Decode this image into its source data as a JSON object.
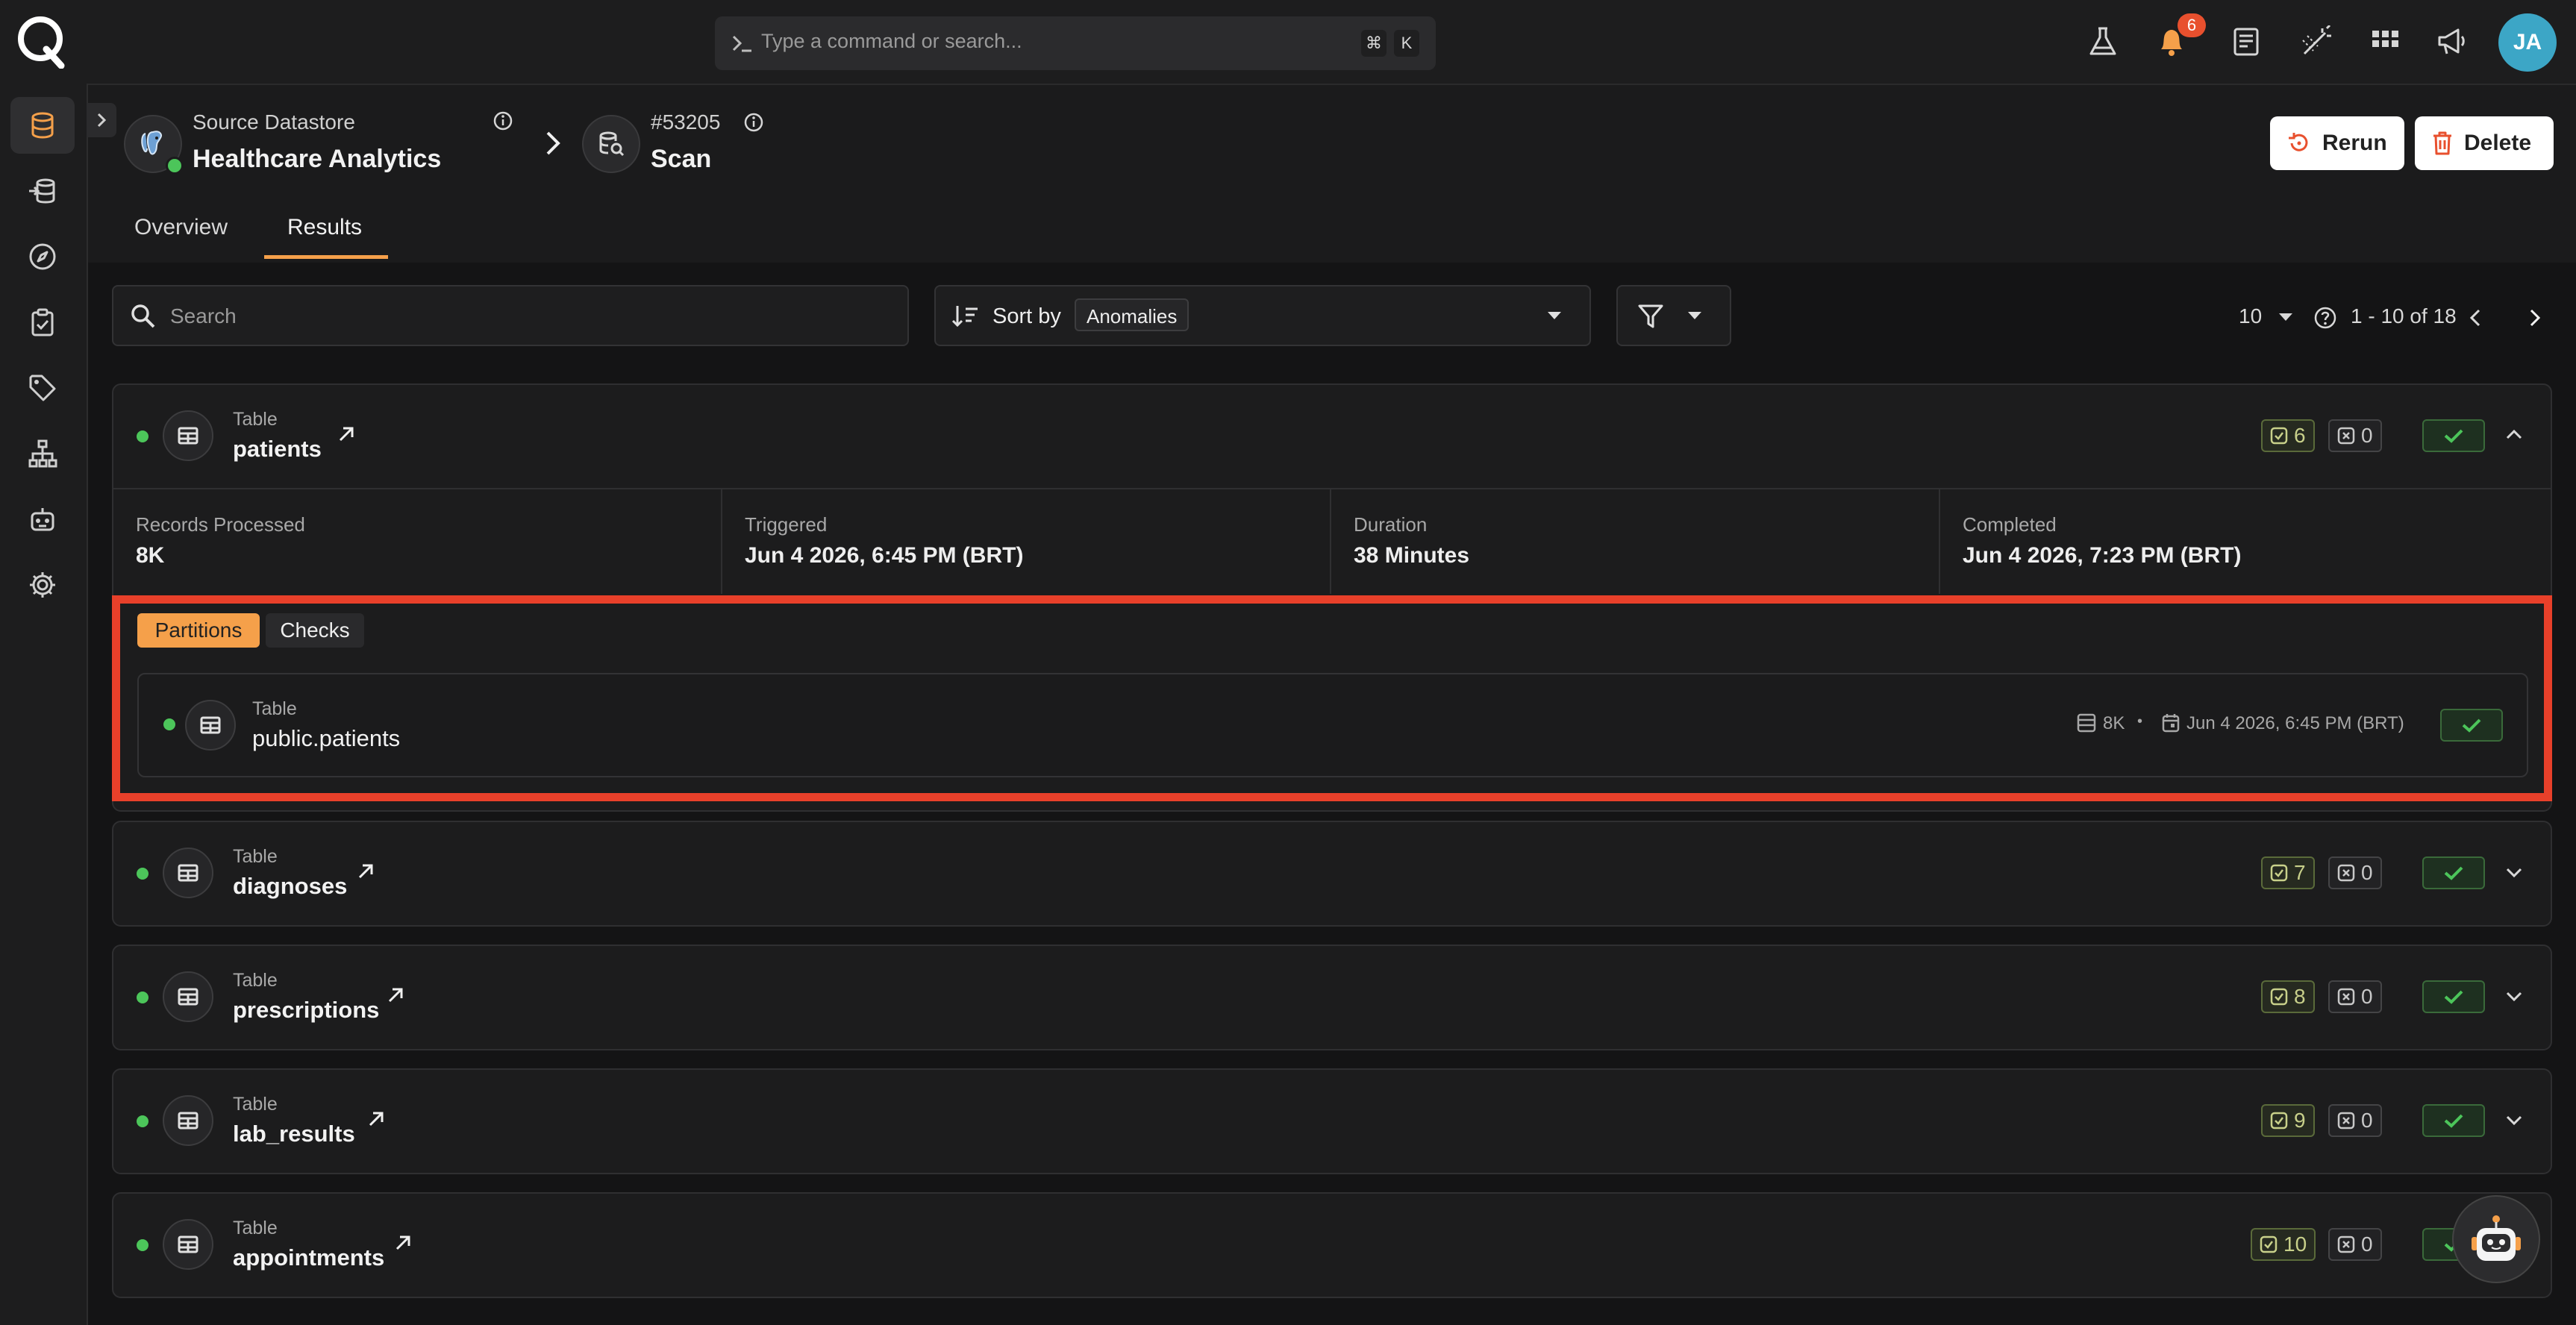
{
  "command_bar": {
    "placeholder": "Type a command or search...",
    "shortcut_key_1": "⌘",
    "shortcut_key_2": "K"
  },
  "notifications": {
    "count": "6"
  },
  "user": {
    "initials": "JA"
  },
  "breadcrumb": {
    "datastore_type": "Source Datastore",
    "datastore_name": "Healthcare Analytics",
    "scan_id": "#53205",
    "scan_label": "Scan"
  },
  "actions": {
    "rerun": "Rerun",
    "delete": "Delete"
  },
  "tabs": [
    {
      "label": "Overview",
      "active": false
    },
    {
      "label": "Results",
      "active": true
    }
  ],
  "toolbar": {
    "search_placeholder": "Search",
    "sort_by_label": "Sort by",
    "sort_value": "Anomalies",
    "page_size": "10",
    "page_range": "1 - 10 of 18"
  },
  "results": [
    {
      "type": "Table",
      "name": "patients",
      "checks_passed": "6",
      "checks_failed": "0",
      "expanded": true,
      "stats": {
        "records_processed_label": "Records Processed",
        "records_processed": "8K",
        "triggered_label": "Triggered",
        "triggered": "Jun 4 2026, 6:45 PM (BRT)",
        "duration_label": "Duration",
        "duration": "38 Minutes",
        "completed_label": "Completed",
        "completed": "Jun 4 2026, 7:23 PM (BRT)"
      },
      "subtabs": {
        "partitions": "Partitions",
        "checks": "Checks"
      },
      "partition": {
        "type": "Table",
        "name": "public.patients",
        "records": "8K",
        "separator": "•",
        "date": "Jun 4 2026, 6:45 PM (BRT)"
      }
    },
    {
      "type": "Table",
      "name": "diagnoses",
      "checks_passed": "7",
      "checks_failed": "0",
      "expanded": false
    },
    {
      "type": "Table",
      "name": "prescriptions",
      "checks_passed": "8",
      "checks_failed": "0",
      "expanded": false
    },
    {
      "type": "Table",
      "name": "lab_results",
      "checks_passed": "9",
      "checks_failed": "0",
      "expanded": false
    },
    {
      "type": "Table",
      "name": "appointments",
      "checks_passed": "10",
      "checks_failed": "0",
      "expanded": false
    }
  ],
  "colors": {
    "accent": "#f5a04a",
    "highlight_border": "#e8402a",
    "status_green": "#4cc55a",
    "badge_red": "#e8502e",
    "avatar": "#3ca6c6"
  }
}
